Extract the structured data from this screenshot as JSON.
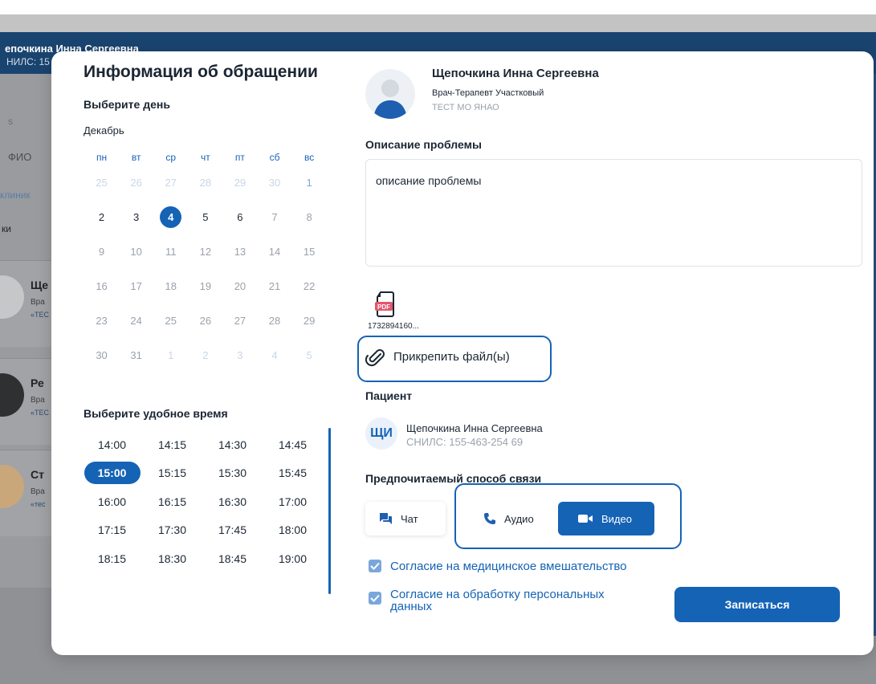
{
  "background": {
    "patient_name": "епочкина Инна Сергеевна",
    "snils_prefix": "НИЛС: 15",
    "rows": [
      "s",
      "ФИО",
      "клиник",
      "ки"
    ],
    "cards": [
      {
        "name": "Ще",
        "role": "Вра",
        "org": "«ТЕС"
      },
      {
        "name": "Ре",
        "role": "Вра",
        "org": "«ТЕС"
      },
      {
        "name": "Ст",
        "role": "Вра",
        "org": "«тес"
      }
    ]
  },
  "modal": {
    "title": "Информация об обращении",
    "choose_day": "Выберите день",
    "month": "Декабрь",
    "weekdays": [
      "пн",
      "вт",
      "ср",
      "чт",
      "пт",
      "сб",
      "вс"
    ],
    "weeks": [
      [
        "25",
        "26",
        "27",
        "28",
        "29",
        "30",
        "1"
      ],
      [
        "2",
        "3",
        "4",
        "5",
        "6",
        "7",
        "8"
      ],
      [
        "9",
        "10",
        "11",
        "12",
        "13",
        "14",
        "15"
      ],
      [
        "16",
        "17",
        "18",
        "19",
        "20",
        "21",
        "22"
      ],
      [
        "23",
        "24",
        "25",
        "26",
        "27",
        "28",
        "29"
      ],
      [
        "30",
        "31",
        "1",
        "2",
        "3",
        "4",
        "5"
      ]
    ],
    "selected_day": "4",
    "choose_time": "Выберите удобное время",
    "times": [
      [
        "14:00",
        "14:15",
        "14:30",
        "14:45"
      ],
      [
        "15:00",
        "15:15",
        "15:30",
        "15:45"
      ],
      [
        "16:00",
        "16:15",
        "16:30",
        "17:00"
      ],
      [
        "17:15",
        "17:30",
        "17:45",
        "18:00"
      ],
      [
        "18:15",
        "18:30",
        "18:45",
        "19:00"
      ]
    ],
    "selected_time": "15:00",
    "doctor": {
      "name": "Щепочкина Инна Сергеевна",
      "specialty": "Врач-Терапевт Участковый",
      "org": "ТЕСТ МО ЯНАО"
    },
    "problem_label": "Описание проблемы",
    "problem_text": "описание проблемы",
    "file_name": "1732894160...",
    "pdf_badge": "PDF",
    "attach_label": "Прикрепить файл(ы)",
    "patient_label": "Пациент",
    "patient": {
      "initials": "ЩИ",
      "name": "Щепочкина Инна Сергеевна",
      "snils": "СНИЛС: 155-463-254 69"
    },
    "contact_label": "Предпочитаемый способ связи",
    "channels": {
      "chat": "Чат",
      "audio": "Аудио",
      "video": "Видео"
    },
    "selected_channel": "Видео",
    "consent_medical": "Согласие на медицинское вмешательство",
    "consent_data_1": "Согласие на обработку персональных",
    "consent_data_2": "данных",
    "submit": "Записаться",
    "colors": {
      "accent": "#1563b5",
      "checkbox": "#7aa7db",
      "muted": "#9aa2ac"
    }
  }
}
